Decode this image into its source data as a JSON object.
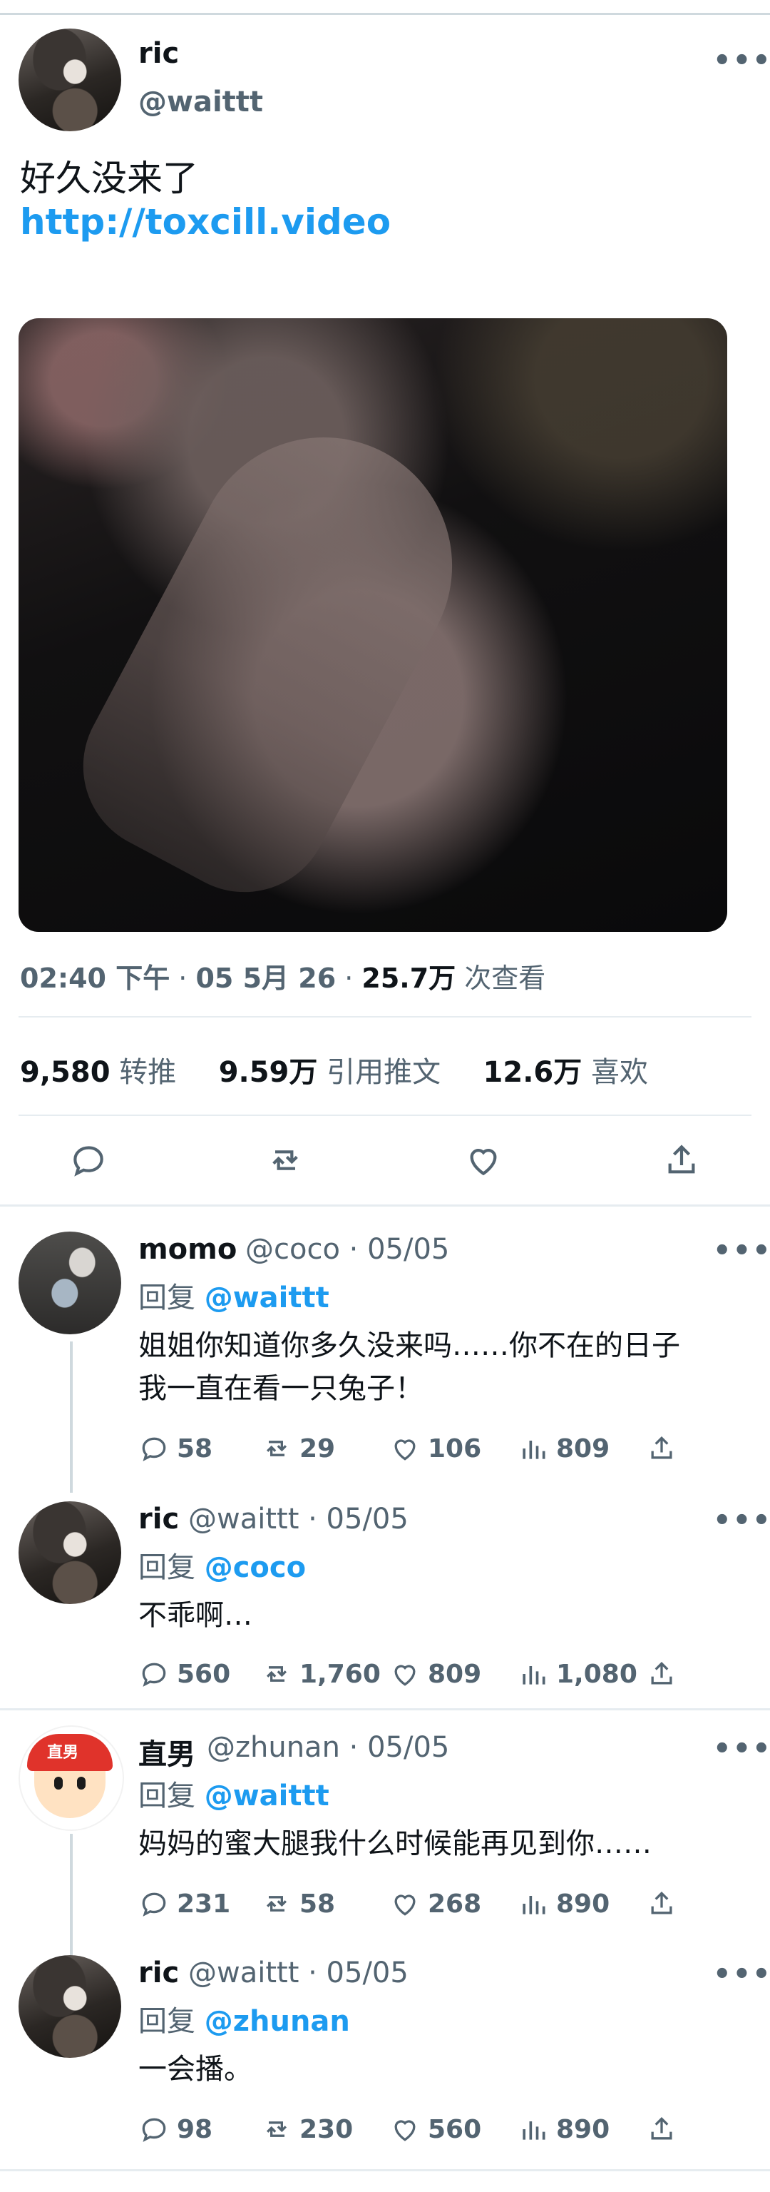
{
  "tweet": {
    "name": "ric",
    "handle": "@waittt",
    "text": "好久没来了",
    "link": "http://toxcill.video",
    "time": "02:40 下午",
    "date": "05 5月 26",
    "views": "25.7万",
    "views_label": "次查看",
    "retweets": "9,580",
    "retweets_label": "转推",
    "quotes": "9.59万",
    "quotes_label": "引用推文",
    "likes": "12.6万",
    "likes_label": "喜欢"
  },
  "replies": [
    {
      "name": "momo",
      "handle": "@coco",
      "date": "· 05/05",
      "reply_prefix": "回复",
      "reply_to": "@waittt",
      "text_line1": "姐姐你知道你多久没来吗……你不在的日子",
      "text_line2": "我一直在看一只兔子！",
      "replies": "58",
      "retweets": "29",
      "likes": "106",
      "views": "809"
    },
    {
      "name": "ric",
      "handle": "@waittt",
      "date": "· 05/05",
      "reply_prefix": "回复",
      "reply_to": "@coco",
      "text_line1": "不乖啊…",
      "replies": "560",
      "retweets": "1,760",
      "likes": "809",
      "views": "1,080"
    },
    {
      "name": "直男",
      "handle": "@zhunan",
      "date": "· 05/05",
      "reply_prefix": "回复",
      "reply_to": "@waittt",
      "text_line1": "妈妈的蜜大腿我什么时候能再见到你……",
      "replies": "231",
      "retweets": "58",
      "likes": "268",
      "views": "890",
      "avatar_text": "直男"
    },
    {
      "name": "ric",
      "handle": "@waittt",
      "date": "· 05/05",
      "reply_prefix": "回复",
      "reply_to": "@zhunan",
      "text_line1": "一会播。",
      "replies": "98",
      "retweets": "230",
      "likes": "560",
      "views": "890"
    }
  ],
  "more_label": "•••",
  "colors": {
    "link": "#1d9bf0",
    "muted": "#536471",
    "text": "#0f1419",
    "divider": "#e6ecf0"
  }
}
